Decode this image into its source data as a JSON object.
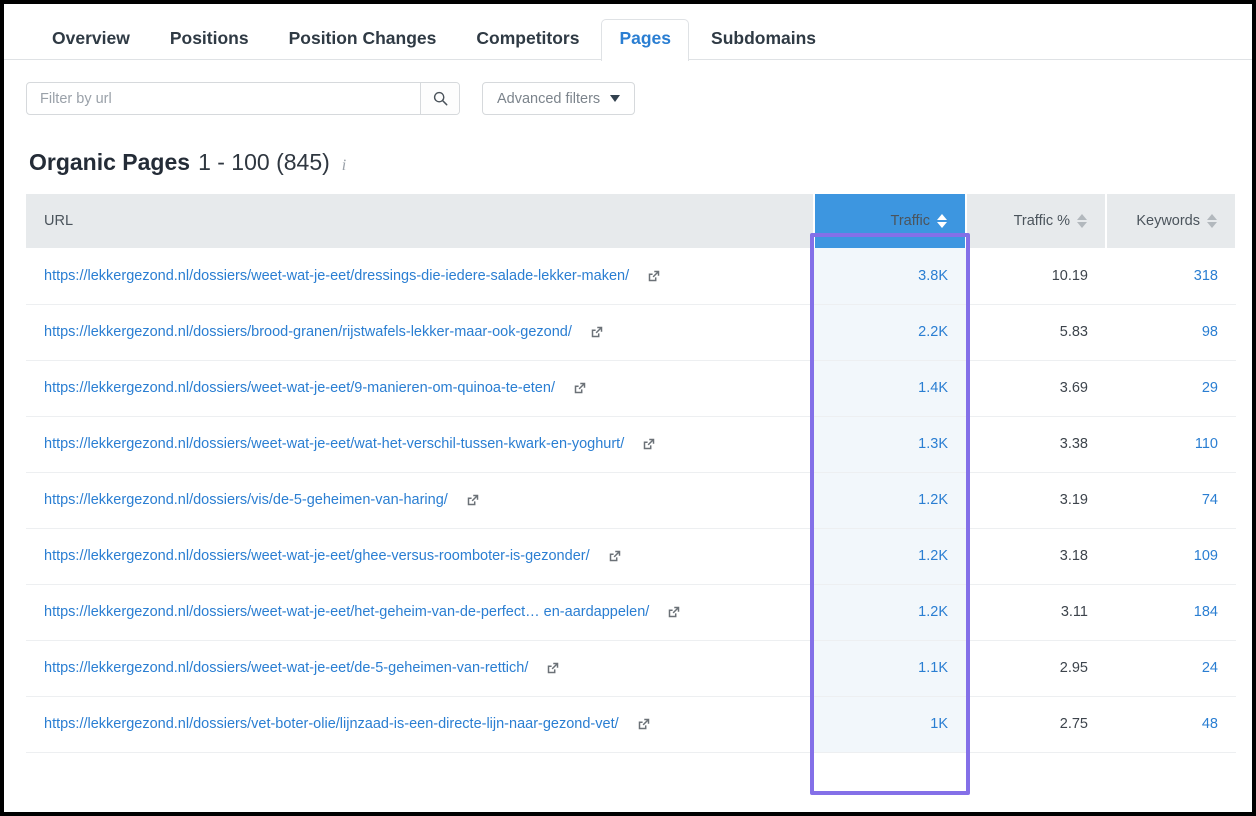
{
  "tabs": [
    {
      "label": "Overview",
      "active": false
    },
    {
      "label": "Positions",
      "active": false
    },
    {
      "label": "Position Changes",
      "active": false
    },
    {
      "label": "Competitors",
      "active": false
    },
    {
      "label": "Pages",
      "active": true
    },
    {
      "label": "Subdomains",
      "active": false
    }
  ],
  "filters": {
    "search_placeholder": "Filter by url",
    "search_value": "",
    "search_icon": "search-icon",
    "advanced_filters_label": "Advanced filters",
    "advanced_filters_icon": "chevron-down-icon"
  },
  "section": {
    "title": "Organic Pages",
    "range": "1 - 100 (845)",
    "info_icon": "info-icon"
  },
  "table": {
    "columns": [
      {
        "key": "url",
        "label": "URL",
        "sortable": false
      },
      {
        "key": "traffic",
        "label": "Traffic",
        "sortable": true,
        "active": true
      },
      {
        "key": "traffic_pct",
        "label": "Traffic %",
        "sortable": true,
        "active": false
      },
      {
        "key": "keywords",
        "label": "Keywords",
        "sortable": true,
        "active": false
      }
    ],
    "rows": [
      {
        "url": "https://lekkergezond.nl/dossiers/weet-wat-je-eet/dressings-die-iedere-salade-lekker-maken/",
        "traffic": "3.8K",
        "traffic_pct": "10.19",
        "keywords": "318"
      },
      {
        "url": "https://lekkergezond.nl/dossiers/brood-granen/rijstwafels-lekker-maar-ook-gezond/",
        "traffic": "2.2K",
        "traffic_pct": "5.83",
        "keywords": "98"
      },
      {
        "url": "https://lekkergezond.nl/dossiers/weet-wat-je-eet/9-manieren-om-quinoa-te-eten/",
        "traffic": "1.4K",
        "traffic_pct": "3.69",
        "keywords": "29"
      },
      {
        "url": "https://lekkergezond.nl/dossiers/weet-wat-je-eet/wat-het-verschil-tussen-kwark-en-yoghurt/",
        "traffic": "1.3K",
        "traffic_pct": "3.38",
        "keywords": "110"
      },
      {
        "url": "https://lekkergezond.nl/dossiers/vis/de-5-geheimen-van-haring/",
        "traffic": "1.2K",
        "traffic_pct": "3.19",
        "keywords": "74"
      },
      {
        "url": "https://lekkergezond.nl/dossiers/weet-wat-je-eet/ghee-versus-roomboter-is-gezonder/",
        "traffic": "1.2K",
        "traffic_pct": "3.18",
        "keywords": "109"
      },
      {
        "url": "https://lekkergezond.nl/dossiers/weet-wat-je-eet/het-geheim-van-de-perfect…  en-aardappelen/",
        "traffic": "1.2K",
        "traffic_pct": "3.11",
        "keywords": "184"
      },
      {
        "url": "https://lekkergezond.nl/dossiers/weet-wat-je-eet/de-5-geheimen-van-rettich/",
        "traffic": "1.1K",
        "traffic_pct": "2.95",
        "keywords": "24"
      },
      {
        "url": "https://lekkergezond.nl/dossiers/vet-boter-olie/lijnzaad-is-een-directe-lijn-naar-gezond-vet/",
        "traffic": "1K",
        "traffic_pct": "2.75",
        "keywords": "48"
      }
    ]
  },
  "colors": {
    "accent_blue": "#2a7ed2",
    "header_active_blue": "#3d96e0",
    "highlight_purple": "#8470e8",
    "header_gray": "#e7eaec",
    "traffic_cell_bg": "#f2f7fb"
  }
}
